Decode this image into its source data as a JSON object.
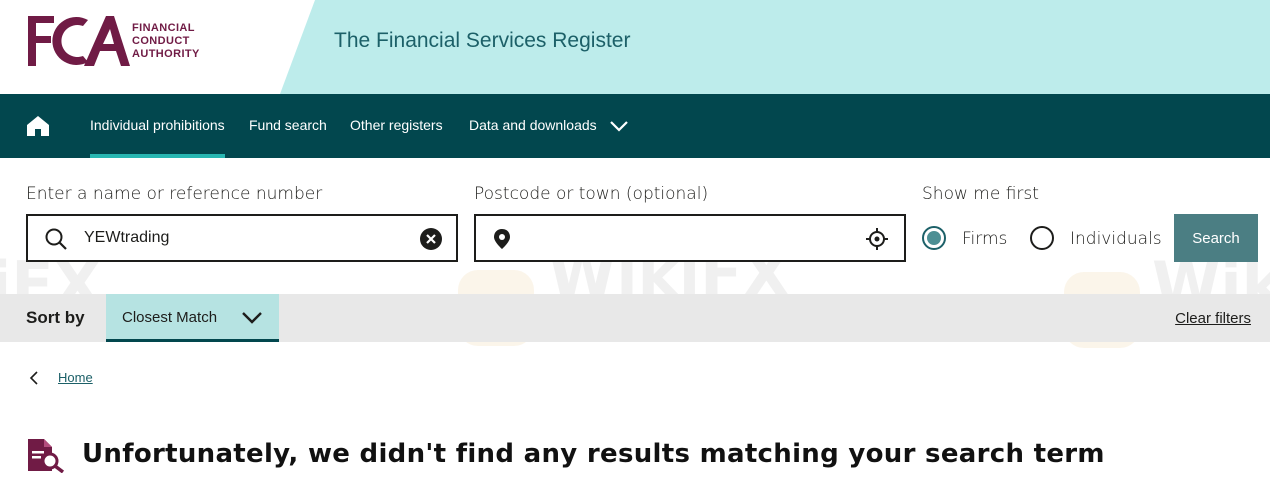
{
  "header": {
    "logo_text": "FCA",
    "logo_words": [
      "FINANCIAL",
      "CONDUCT",
      "AUTHORITY"
    ],
    "title": "The Financial Services Register"
  },
  "nav": {
    "home_icon": "home-icon",
    "items": [
      {
        "label": "Individual prohibitions",
        "active": true
      },
      {
        "label": "Fund search",
        "active": false
      },
      {
        "label": "Other registers",
        "active": false
      },
      {
        "label": "Data and downloads",
        "active": false,
        "has_dropdown": true
      }
    ]
  },
  "search": {
    "name_label": "Enter a name or reference number",
    "name_value": "YEWtrading",
    "postcode_label": "Postcode or town (optional)",
    "postcode_value": "",
    "show_me_first_label": "Show me first",
    "options": [
      {
        "label": "Firms",
        "checked": true
      },
      {
        "label": "Individuals",
        "checked": false
      }
    ],
    "search_button": "Search"
  },
  "sort": {
    "label": "Sort by",
    "selected": "Closest Match",
    "clear_filters": "Clear filters"
  },
  "breadcrumb": {
    "home": "Home"
  },
  "results": {
    "message": "Unfortunately, we didn't find any results matching your search term"
  },
  "colors": {
    "brand": "#701b45",
    "nav_bg": "#02474e",
    "header_bg": "#bdeceb",
    "accent": "#28b6b1",
    "button": "#4b7e83"
  }
}
